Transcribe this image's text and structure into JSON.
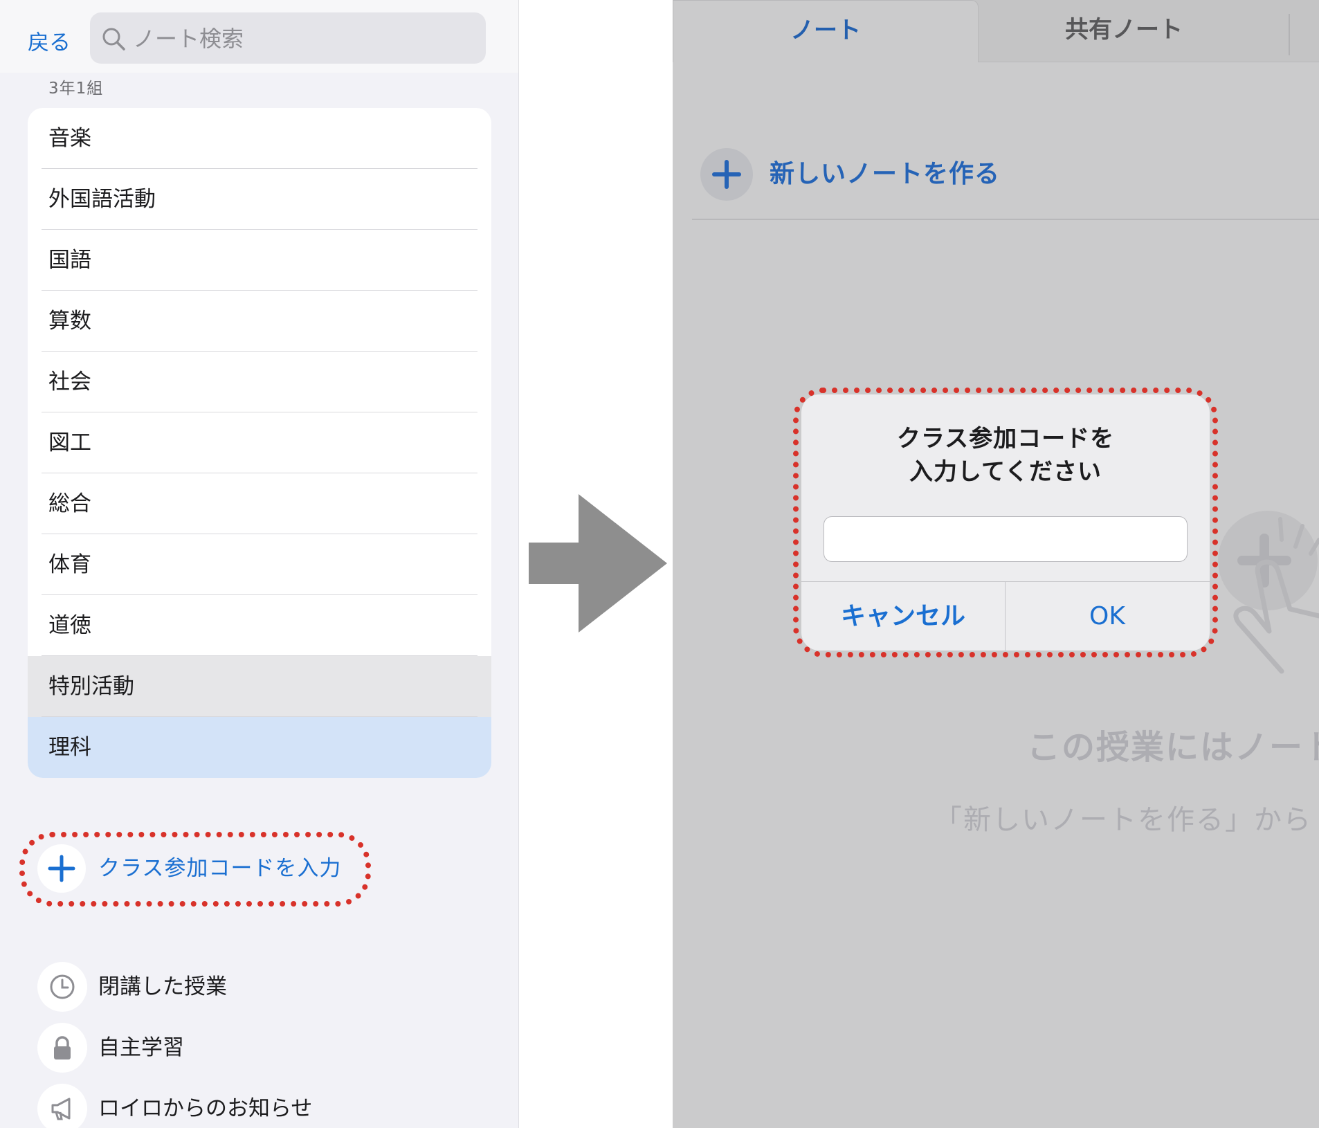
{
  "left_panel": {
    "back_label": "戻る",
    "search": {
      "placeholder": "ノート検索",
      "value": ""
    },
    "section_label": "3年1組",
    "subjects": [
      {
        "label": "音楽",
        "state": "normal"
      },
      {
        "label": "外国語活動",
        "state": "normal"
      },
      {
        "label": "国語",
        "state": "normal"
      },
      {
        "label": "算数",
        "state": "normal"
      },
      {
        "label": "社会",
        "state": "normal"
      },
      {
        "label": "図工",
        "state": "normal"
      },
      {
        "label": "総合",
        "state": "normal"
      },
      {
        "label": "体育",
        "state": "normal"
      },
      {
        "label": "道徳",
        "state": "normal"
      },
      {
        "label": "特別活動",
        "state": "pressed"
      },
      {
        "label": "理科",
        "state": "selected"
      }
    ],
    "join_code_label": "クラス参加コードを入力",
    "menu": [
      {
        "label": "閉講した授業",
        "icon": "clock-icon"
      },
      {
        "label": "自主学習",
        "icon": "lock-icon"
      },
      {
        "label": "ロイロからのお知らせ",
        "icon": "megaphone-icon"
      }
    ]
  },
  "right_panel": {
    "tabs": [
      {
        "label": "ノート",
        "active": true
      },
      {
        "label": "共有ノート",
        "active": false
      }
    ],
    "new_note_label": "新しいノートを作る",
    "empty_title": "この授業にはノート",
    "empty_subtitle": "「新しいノートを作る」から"
  },
  "dialog": {
    "title_line1": "クラス参加コードを",
    "title_line2": "入力してください",
    "input_value": "",
    "cancel_label": "キャンセル",
    "ok_label": "OK"
  },
  "colors": {
    "accent": "#1a6fd1",
    "highlight_dash": "#d8322a",
    "selected_row": "#d3e3f8",
    "arrow": "#8e8e8e"
  }
}
